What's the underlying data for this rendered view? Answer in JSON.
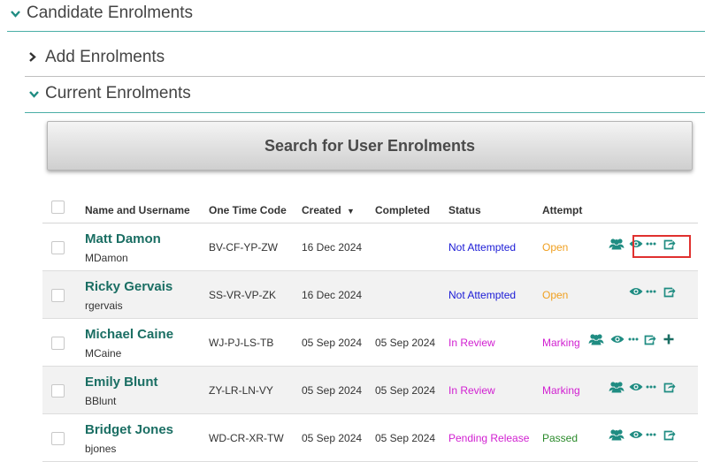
{
  "sections": {
    "candidate": "Candidate Enrolments",
    "add": "Add Enrolments",
    "current": "Current Enrolments"
  },
  "search_button": "Search for User Enrolments",
  "table": {
    "headers": {
      "name": "Name and Username",
      "code": "One Time Code",
      "created": "Created",
      "created_sort": "▼",
      "completed": "Completed",
      "status": "Status",
      "attempt": "Attempt"
    },
    "rows": [
      {
        "name": "Matt Damon",
        "username": "MDamon",
        "code": "BV-CF-YP-ZW",
        "created": "16 Dec 2024",
        "completed": "",
        "status": "Not Attempted",
        "attempt": "Open",
        "icons": [
          "group-icon",
          "view-icon",
          "more-icon",
          "export-icon"
        ]
      },
      {
        "name": "Ricky Gervais",
        "username": "rgervais",
        "code": "SS-VR-VP-ZK",
        "created": "16 Dec 2024",
        "completed": "",
        "status": "Not Attempted",
        "attempt": "Open",
        "icons": [
          "view-icon",
          "more-icon",
          "export-icon"
        ]
      },
      {
        "name": "Michael Caine",
        "username": "MCaine",
        "code": "WJ-PJ-LS-TB",
        "created": "05 Sep 2024",
        "completed": "05 Sep 2024",
        "status": "In Review",
        "attempt": "Marking",
        "icons": [
          "group-icon",
          "view-icon",
          "more-icon",
          "export-icon",
          "plus-icon"
        ]
      },
      {
        "name": "Emily Blunt",
        "username": "BBlunt",
        "code": "ZY-LR-LN-VY",
        "created": "05 Sep 2024",
        "completed": "05 Sep 2024",
        "status": "In Review",
        "attempt": "Marking",
        "icons": [
          "group-icon",
          "view-icon",
          "more-icon",
          "export-icon"
        ]
      },
      {
        "name": "Bridget Jones",
        "username": "bjones",
        "code": "WD-CR-XR-TW",
        "created": "05 Sep 2024",
        "completed": "05 Sep 2024",
        "status": "Pending Release",
        "attempt": "Passed",
        "icons": [
          "group-icon",
          "view-icon",
          "more-icon",
          "export-icon"
        ]
      }
    ]
  },
  "colors": {
    "accent": "#1f8c82",
    "name_link": "#1a6e63",
    "status_not_attempted": "#1a1ad6",
    "status_in_review": "#d11fd1",
    "status_pending_release": "#d11fd1",
    "attempt_open": "#f0a020",
    "attempt_marking": "#d11fd1",
    "attempt_passed": "#2a8a2a",
    "highlight": "#e0312f"
  }
}
